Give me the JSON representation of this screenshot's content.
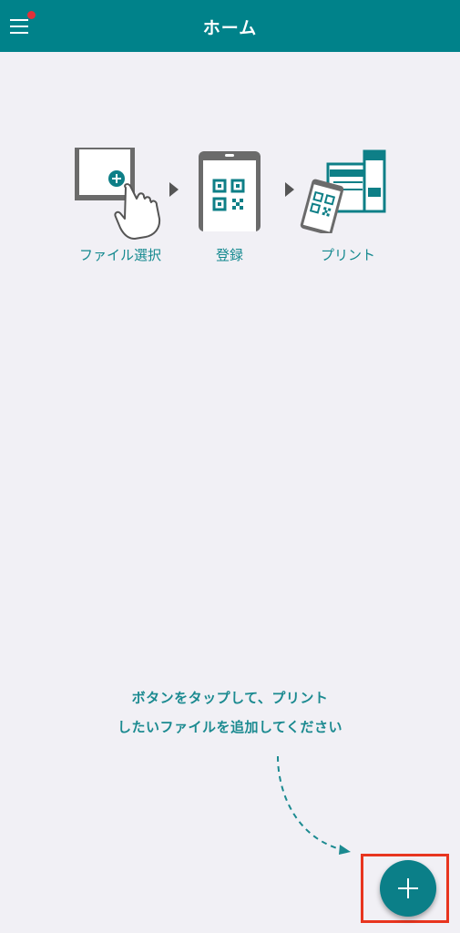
{
  "header": {
    "title": "ホーム",
    "menu_icon": "hamburger-menu-icon",
    "notification_color": "#e0313a"
  },
  "steps": [
    {
      "label": "ファイル選択",
      "icon": "tablet-tap-icon"
    },
    {
      "label": "登録",
      "icon": "phone-qr-icon"
    },
    {
      "label": "プリント",
      "icon": "printer-phone-icon"
    }
  ],
  "instruction": {
    "line1": "ボタンをタップして、プリント",
    "line2": "したいファイルを追加してください"
  },
  "fab": {
    "icon": "plus-icon"
  },
  "colors": {
    "accent": "#00828a",
    "background": "#f1f0f5",
    "highlight": "#e8351f"
  }
}
